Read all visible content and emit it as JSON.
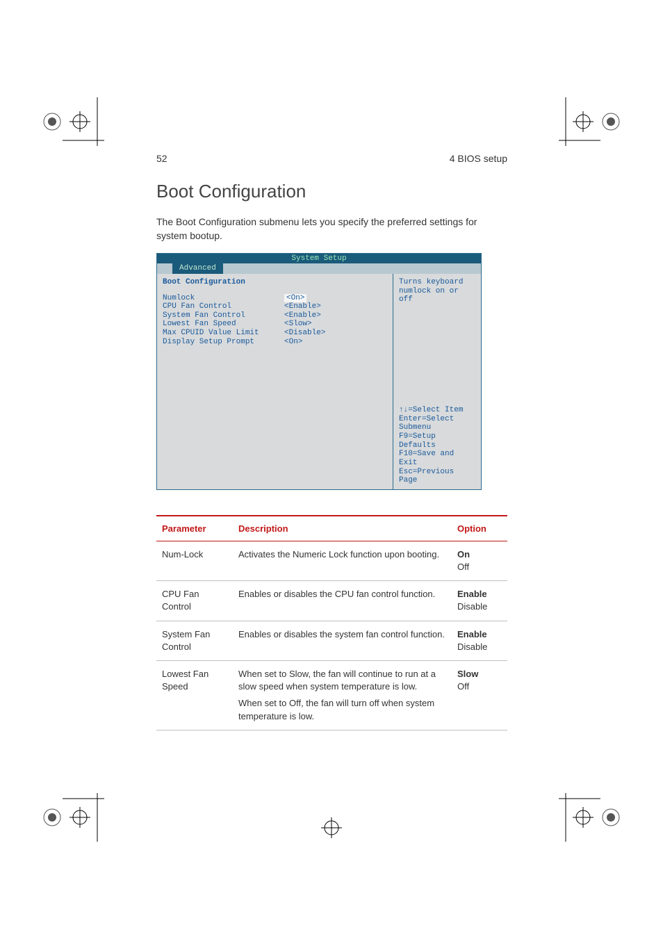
{
  "page": {
    "number": "52",
    "section": "4 BIOS setup",
    "title": "Boot Configuration",
    "intro": "The Boot Configuration submenu lets you specify the preferred settings for system bootup."
  },
  "bios": {
    "window_title": "System Setup",
    "active_tab": "Advanced",
    "section_heading": "Boot Configuration",
    "items": [
      {
        "label": "Numlock",
        "value": "<On>",
        "highlighted": true
      },
      {
        "label": "CPU Fan Control",
        "value": "<Enable>",
        "highlighted": false
      },
      {
        "label": "System Fan Control",
        "value": "<Enable>",
        "highlighted": false
      },
      {
        "label": "Lowest Fan Speed",
        "value": "<Slow>",
        "highlighted": false
      },
      {
        "label": "Max CPUID Value Limit",
        "value": "<Disable>",
        "highlighted": false
      },
      {
        "label": "Display Setup Prompt",
        "value": "<On>",
        "highlighted": false
      }
    ],
    "help_text": "Turns keyboard numlock on or off",
    "key_hints": [
      "↑↓=Select Item",
      "Enter=Select Submenu",
      "F9=Setup Defaults",
      "F10=Save and Exit",
      "Esc=Previous Page"
    ]
  },
  "table": {
    "headers": {
      "param": "Parameter",
      "desc": "Description",
      "opt": "Option"
    },
    "rows": [
      {
        "param": "Num-Lock",
        "desc": [
          "Activates the Numeric Lock function upon booting."
        ],
        "options": [
          {
            "text": "On",
            "bold": true
          },
          {
            "text": "Off",
            "bold": false
          }
        ]
      },
      {
        "param": "CPU Fan Control",
        "desc": [
          "Enables or disables the CPU fan control function."
        ],
        "options": [
          {
            "text": "Enable",
            "bold": true
          },
          {
            "text": "Disable",
            "bold": false
          }
        ]
      },
      {
        "param": "System Fan Control",
        "desc": [
          "Enables or disables the system fan control function."
        ],
        "options": [
          {
            "text": "Enable",
            "bold": true
          },
          {
            "text": "Disable",
            "bold": false
          }
        ]
      },
      {
        "param": "Lowest Fan Speed",
        "desc": [
          "When set to Slow, the fan will continue to run at a slow speed when system temperature is low.",
          "When set to Off, the fan will turn off when system temperature is low."
        ],
        "options": [
          {
            "text": "Slow",
            "bold": true
          },
          {
            "text": "Off",
            "bold": false
          }
        ]
      }
    ]
  }
}
